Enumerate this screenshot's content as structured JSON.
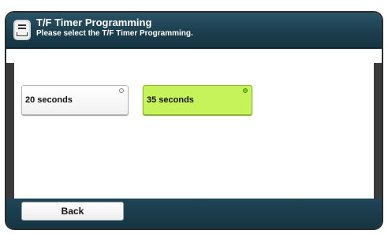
{
  "header": {
    "title": "T/F Timer Programming",
    "subtitle": "Please select the T/F Timer Programming.",
    "icon": "document-tray-icon"
  },
  "options": [
    {
      "label": "20 seconds",
      "selected": false
    },
    {
      "label": "35 seconds",
      "selected": true
    }
  ],
  "footer": {
    "back_label": "Back"
  },
  "colors": {
    "header_bg": "#1b3d4c",
    "selected_bg": "#c6f25a",
    "selected_indicator": "#7ed321"
  }
}
